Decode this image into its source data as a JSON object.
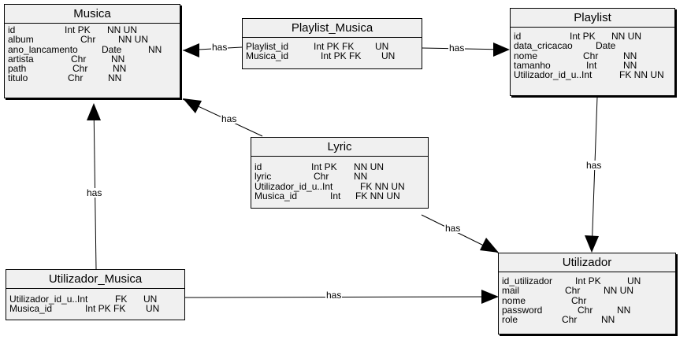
{
  "entities": {
    "musica": {
      "title": "Musica",
      "rows": [
        [
          "id",
          "Int PK",
          "NN UN"
        ],
        [
          "album",
          "Chr",
          "NN UN"
        ],
        [
          "ano_lancamento",
          "Date",
          "NN"
        ],
        [
          "artista",
          "Chr",
          "NN"
        ],
        [
          "path",
          "Chr",
          "NN"
        ],
        [
          "titulo",
          "Chr",
          "NN"
        ]
      ]
    },
    "playlist_musica": {
      "title": "Playlist_Musica",
      "rows": [
        [
          "Playlist_id",
          "Int PK FK",
          "UN"
        ],
        [
          "Musica_id",
          "Int PK FK",
          "UN"
        ]
      ]
    },
    "playlist": {
      "title": "Playlist",
      "rows": [
        [
          "id",
          "Int PK",
          "NN UN"
        ],
        [
          "data_cricacao",
          "Date",
          ""
        ],
        [
          "nome",
          "Chr",
          "NN"
        ],
        [
          "tamanho",
          "Int",
          "NN"
        ],
        [
          "Utilizador_id_u..Int",
          "",
          "FK NN UN"
        ]
      ]
    },
    "lyric": {
      "title": "Lyric",
      "rows": [
        [
          "id",
          "Int PK",
          "NN UN"
        ],
        [
          "lyric",
          "Chr",
          "NN"
        ],
        [
          "Utilizador_id_u..Int",
          "",
          "FK NN UN"
        ],
        [
          "Musica_id",
          "Int",
          "FK NN UN"
        ]
      ]
    },
    "utilizador_musica": {
      "title": "Utilizador_Musica",
      "rows": [
        [
          "Utilizador_id_u..Int",
          "FK",
          "UN"
        ],
        [
          "Musica_id",
          "Int PK FK",
          "UN"
        ]
      ]
    },
    "utilizador": {
      "title": "Utilizador",
      "rows": [
        [
          "id_utilizador",
          "Int PK",
          "UN"
        ],
        [
          "mail",
          "Chr",
          "NN UN"
        ],
        [
          "nome",
          "Chr",
          ""
        ],
        [
          "password",
          "Chr",
          "NN"
        ],
        [
          "role",
          "Chr",
          "NN"
        ]
      ]
    }
  },
  "edges": {
    "pm_musica": "has",
    "pm_playlist": "has",
    "lyric_musica": "has",
    "playlist_utilizador": "has",
    "lyric_utilizador": "has",
    "um_musica": "has",
    "um_utilizador": "has"
  }
}
